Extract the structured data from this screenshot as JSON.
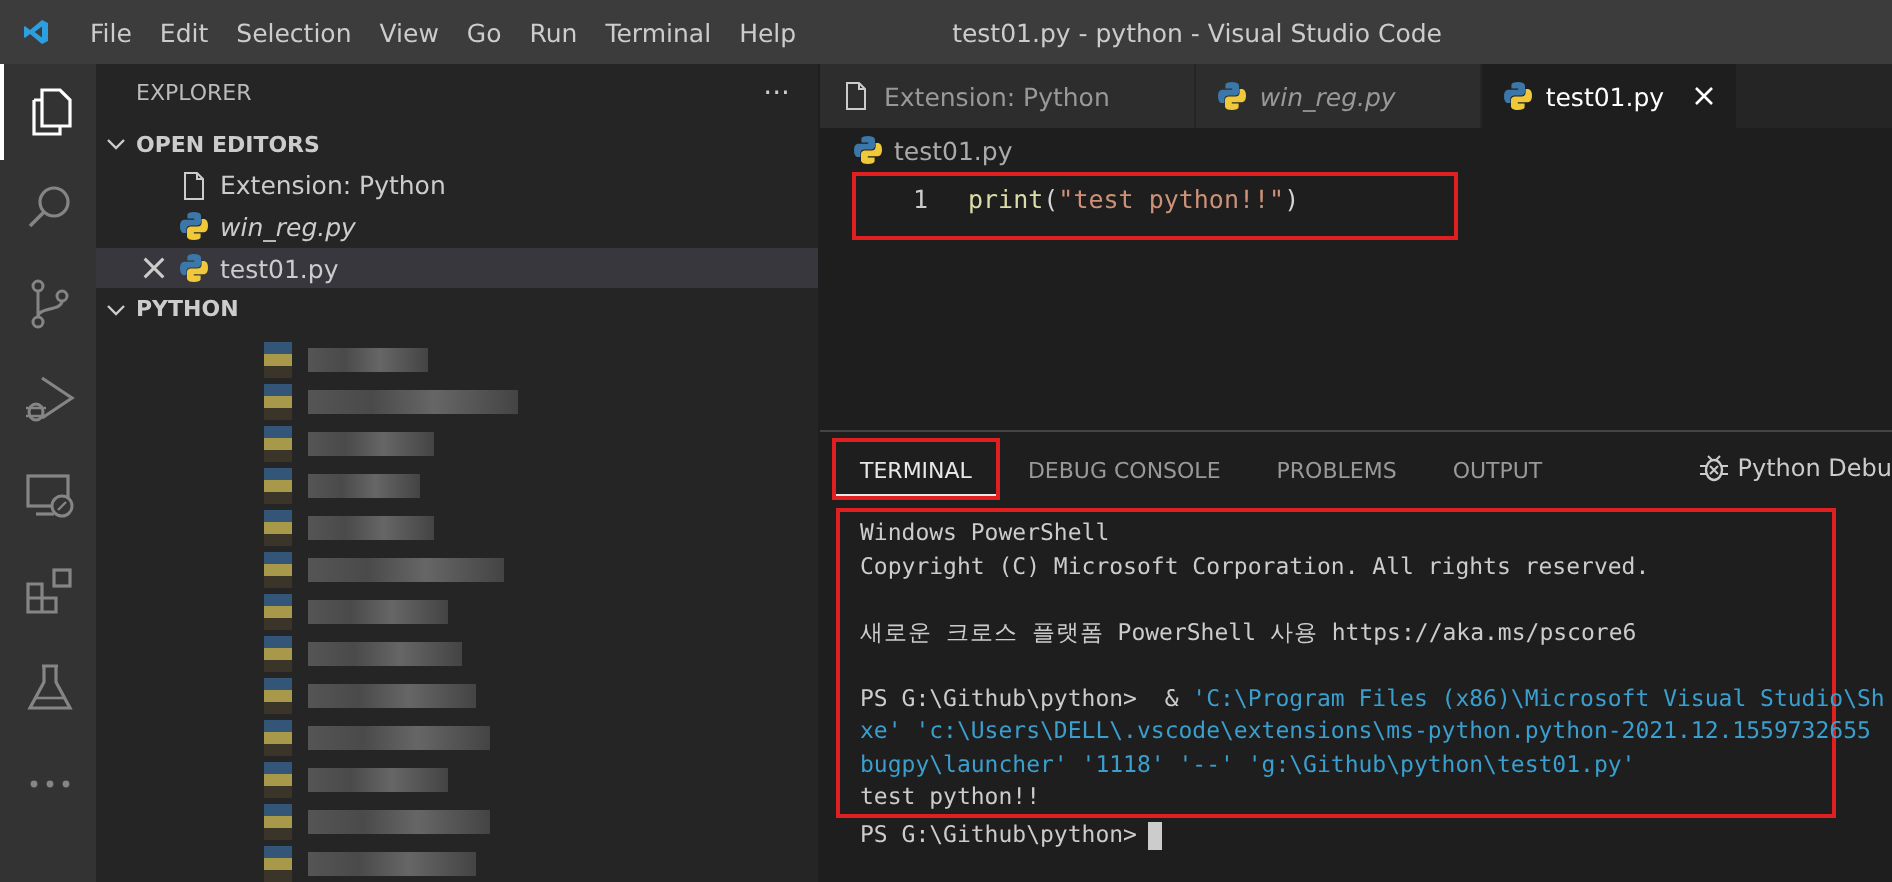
{
  "window": {
    "title": "test01.py - python - Visual Studio Code"
  },
  "menu": [
    "File",
    "Edit",
    "Selection",
    "View",
    "Go",
    "Run",
    "Terminal",
    "Help"
  ],
  "activity_bar": [
    {
      "kind": "files",
      "selected": true
    },
    {
      "kind": "search",
      "selected": false
    },
    {
      "kind": "scm",
      "selected": false
    },
    {
      "kind": "debug",
      "selected": false
    },
    {
      "kind": "remote",
      "selected": false
    },
    {
      "kind": "extensions",
      "selected": false
    },
    {
      "kind": "testing",
      "selected": false
    },
    {
      "kind": "more",
      "selected": false
    }
  ],
  "sidebar": {
    "title": "EXPLORER",
    "more": "···",
    "sections": [
      {
        "label": "OPEN EDITORS",
        "expanded": true,
        "items": [
          {
            "label": "Extension: Python",
            "kind": "page",
            "italic": false,
            "selected": false
          },
          {
            "label": "win_reg.py",
            "kind": "python",
            "italic": true,
            "selected": false
          },
          {
            "label": "test01.py",
            "kind": "python",
            "italic": false,
            "selected": true
          }
        ]
      },
      {
        "label": "PYTHON",
        "expanded": true
      }
    ]
  },
  "tabs": [
    {
      "label": "Extension: Python",
      "kind": "page",
      "italic": false,
      "selected": false
    },
    {
      "label": "win_reg.py",
      "kind": "python",
      "italic": true,
      "selected": false
    },
    {
      "label": "test01.py",
      "kind": "python",
      "italic": false,
      "selected": true
    }
  ],
  "breadcrumb": "test01.py",
  "editor": {
    "highlighted": true,
    "lines": [
      {
        "number": "1",
        "tokens": [
          {
            "kind": "function",
            "text": "print"
          },
          {
            "kind": "punct",
            "text": "("
          },
          {
            "kind": "string",
            "text": "\"test python!!\""
          },
          {
            "kind": "punct",
            "text": ")"
          }
        ]
      }
    ]
  },
  "panel": {
    "tabs": [
      {
        "label": "TERMINAL",
        "selected": true,
        "highlighted": true
      },
      {
        "label": "DEBUG CONSOLE",
        "selected": false,
        "highlighted": false
      },
      {
        "label": "PROBLEMS",
        "selected": false,
        "highlighted": false
      },
      {
        "label": "OUTPUT",
        "selected": false,
        "highlighted": false
      }
    ],
    "launch": "Python Debu",
    "output": {
      "highlighted": true,
      "lines": [
        {
          "kind": "text",
          "segments": [
            {
              "kind": "plain",
              "text": "Windows PowerShell"
            }
          ]
        },
        {
          "kind": "text",
          "segments": [
            {
              "kind": "plain",
              "text": "Copyright (C) Microsoft Corporation. All rights reserved."
            }
          ]
        },
        {
          "kind": "blank"
        },
        {
          "kind": "text",
          "segments": [
            {
              "kind": "plain",
              "text": "새로운 크로스 플랫폼 PowerShell 사용 https://aka.ms/pscore6"
            }
          ]
        },
        {
          "kind": "blank"
        },
        {
          "kind": "text",
          "segments": [
            {
              "kind": "plain",
              "text": "PS G:\\Github\\python>  & "
            },
            {
              "kind": "path",
              "text": "'C:\\Program Files (x86)\\Microsoft Visual Studio\\Sh"
            }
          ]
        },
        {
          "kind": "text",
          "segments": [
            {
              "kind": "path",
              "text": "xe' 'c:\\Users\\DELL\\.vscode\\extensions\\ms-python.python-2021.12.1559732655"
            }
          ]
        },
        {
          "kind": "text",
          "segments": [
            {
              "kind": "path",
              "text": "bugpy\\launcher' '1118' '--' 'g:\\Github\\python\\test01.py'"
            }
          ]
        },
        {
          "kind": "text",
          "segments": [
            {
              "kind": "plain",
              "text": "test python!!"
            }
          ]
        }
      ]
    },
    "prompt": "PS G:\\Github\\python>"
  }
}
